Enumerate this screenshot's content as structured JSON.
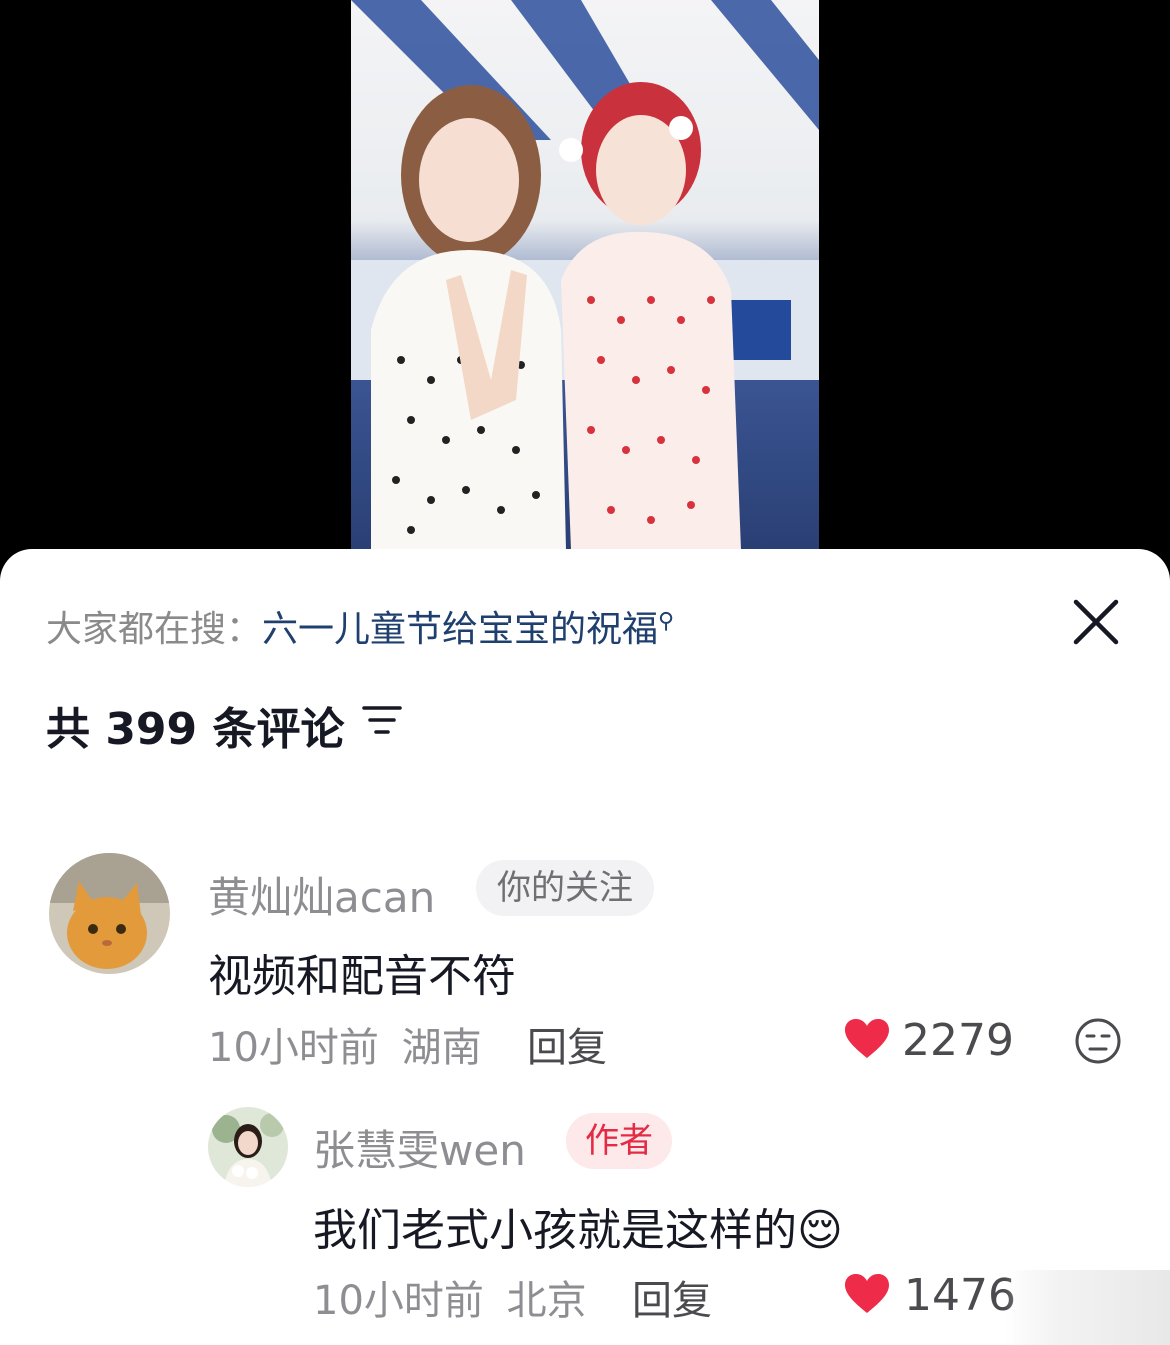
{
  "search": {
    "prefix": "大家都在搜：",
    "keyword": "六一儿童节给宝宝的祝福"
  },
  "comments_header": {
    "text": "共 399 条评论"
  },
  "comments": [
    {
      "user": "黄灿灿acan",
      "badge": "你的关注",
      "text": "视频和配音不符",
      "time": "10小时前",
      "location": "湖南",
      "reply_label": "回复",
      "likes": "2279"
    },
    {
      "user": "张慧雯wen",
      "badge": "作者",
      "text": "我们老式小孩就是这样的😌",
      "time": "10小时前",
      "location": "北京",
      "reply_label": "回复",
      "likes": "1476"
    }
  ],
  "colors": {
    "like_red": "#ee2c4a",
    "author_badge_bg": "#fde8ea",
    "author_badge_text": "#e32b45",
    "follow_badge_bg": "#f2f2f4"
  },
  "icons": {
    "close": "close-icon",
    "filter": "filter-icon",
    "like": "heart-icon",
    "dislike": "neutral-face-icon"
  }
}
